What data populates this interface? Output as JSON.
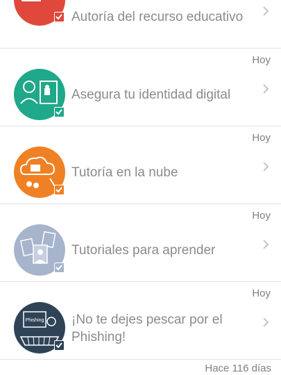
{
  "items": [
    {
      "title": "Autoría del recurso educativo",
      "color": "#e0483b",
      "check_color": "#e0483b",
      "icon": "author-icon",
      "date": ""
    },
    {
      "title": "Asegura tu identidad digital",
      "color": "#1fa88a",
      "check_color": "#1fa88a",
      "icon": "identity-icon",
      "date": "Hoy"
    },
    {
      "title": "Tutoría en la nube",
      "color": "#ef8124",
      "check_color": "#ef8124",
      "icon": "cloud-icon",
      "date": "Hoy"
    },
    {
      "title": "Tutoriales para aprender",
      "color": "#a6b4cc",
      "check_color": "#a6b4cc",
      "icon": "tutorials-icon",
      "date": "Hoy"
    },
    {
      "title": "¡No te dejes pescar por el Phishing!",
      "color": "#2e4356",
      "check_color": "#2e4356",
      "icon": "phishing-icon",
      "icon_text": "Phishing",
      "date": "Hoy"
    }
  ],
  "footer": {
    "date": "Hace 116 días"
  }
}
